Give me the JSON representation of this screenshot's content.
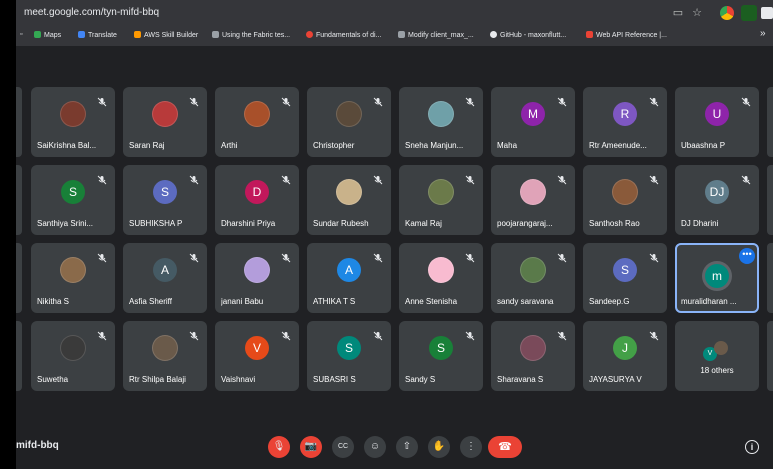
{
  "browser": {
    "url": "meet.google.com/tyn-mifd-bbq",
    "bookmarks": [
      {
        "label": "Maps",
        "color": "#34a853"
      },
      {
        "label": "Translate",
        "color": "#4285f4"
      },
      {
        "label": "AWS Skill Builder",
        "color": "#ff9900"
      },
      {
        "label": "Using the Fabric tes...",
        "color": "#9aa0a6"
      },
      {
        "label": "Fundamentals of di...",
        "color": "#ea4335"
      },
      {
        "label": "Modify client_max_...",
        "color": "#9aa0a6"
      },
      {
        "label": "GitHub - maxonflutt...",
        "color": "#e8eaed"
      },
      {
        "label": "Web API Reference |...",
        "color": "#ea4335"
      }
    ],
    "more": "»"
  },
  "participants": [
    {
      "name": "SaiKrishna Bal...",
      "initial": "",
      "color": "#7a3b2e"
    },
    {
      "name": "Saran Raj",
      "initial": "",
      "color": "#b83a3a"
    },
    {
      "name": "Arthi",
      "initial": "",
      "color": "#a8502a"
    },
    {
      "name": "Christopher",
      "initial": "",
      "color": "#5a4a3a"
    },
    {
      "name": "Sneha Manjun...",
      "initial": "",
      "color": "#6fa0a8"
    },
    {
      "name": "Maha",
      "initial": "M",
      "color": "#8e24aa"
    },
    {
      "name": "Rtr Ameenude...",
      "initial": "R",
      "color": "#7e57c2"
    },
    {
      "name": "Ubaashna P",
      "initial": "U",
      "color": "#8e24aa"
    },
    {
      "name": "Santhiya Srini...",
      "initial": "S",
      "color": "#188038"
    },
    {
      "name": "SUBHIKSHA P",
      "initial": "S",
      "color": "#5c6bc0"
    },
    {
      "name": "Dharshini Priya",
      "initial": "D",
      "color": "#c2185b"
    },
    {
      "name": "Sundar Rubesh",
      "initial": "",
      "color": "#c9b28a"
    },
    {
      "name": "Kamal Raj",
      "initial": "",
      "color": "#6b7a4a"
    },
    {
      "name": "poojarangaraj...",
      "initial": "",
      "color": "#e0a3b8"
    },
    {
      "name": "Santhosh Rao",
      "initial": "",
      "color": "#8a5a3a"
    },
    {
      "name": "DJ Dharini",
      "initial": "DJ",
      "color": "#607d8b"
    },
    {
      "name": "Nikitha S",
      "initial": "",
      "color": "#8a6a4a"
    },
    {
      "name": "Asfia Sheriff",
      "initial": "A",
      "color": "#455a64"
    },
    {
      "name": "janani Babu",
      "initial": "",
      "color": "#b39ddb"
    },
    {
      "name": "ATHIKA T S",
      "initial": "A",
      "color": "#1e88e5"
    },
    {
      "name": "Anne Stenisha",
      "initial": "",
      "color": "#f8bbd0"
    },
    {
      "name": "sandy saravana",
      "initial": "",
      "color": "#5a7a4a"
    },
    {
      "name": "Sandeep.G",
      "initial": "S",
      "color": "#5c6bc0"
    },
    {
      "name": "muralidharan ...",
      "initial": "m",
      "color": "#00897b"
    },
    {
      "name": "Suwetha",
      "initial": "",
      "color": "#3a3a3a"
    },
    {
      "name": "Rtr Shilpa Balaji",
      "initial": "",
      "color": "#6a5a4a"
    },
    {
      "name": "Vaishnavi",
      "initial": "V",
      "color": "#e64a19"
    },
    {
      "name": "SUBASRI S",
      "initial": "S",
      "color": "#00897b"
    },
    {
      "name": "Sandy S",
      "initial": "S",
      "color": "#188038"
    },
    {
      "name": "Sharavana S",
      "initial": "",
      "color": "#7a4a5a"
    },
    {
      "name": "JAYASURYA V",
      "initial": "J",
      "color": "#43a047"
    }
  ],
  "others": {
    "label": "18 others",
    "initial": "V",
    "color": "#00897b"
  },
  "active_menu": "•••",
  "meeting_code": "mifd-bbq",
  "controls": {
    "mic": "🎙",
    "cam": "📷",
    "cc": "CC",
    "emoji": "☺",
    "present": "⇧",
    "hand": "✋",
    "more": "⋮",
    "leave": "☎",
    "info": "i"
  }
}
